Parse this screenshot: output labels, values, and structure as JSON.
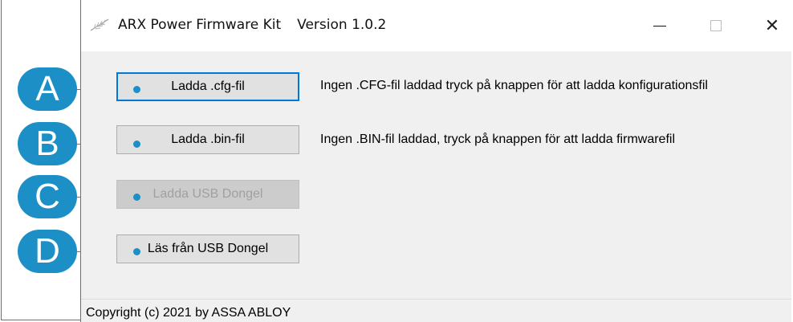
{
  "window": {
    "title": "ARX Power Firmware Kit",
    "version": "Version 1.0.2",
    "app_icon": "feather-icon",
    "minimize_icon": "minimize-icon",
    "maximize_icon": "maximize-icon",
    "close_icon": "close-icon",
    "close_glyph": "✕"
  },
  "buttons": {
    "load_cfg": "Ladda .cfg-fil",
    "load_bin": "Ladda .bin-fil",
    "load_usb": "Ladda USB Dongel",
    "read_usb": "Läs från USB Dongel"
  },
  "status": {
    "cfg": "Ingen .CFG-fil laddad tryck på knappen för att ladda konfigurationsfil",
    "bin": "Ingen .BIN-fil laddad, tryck på knappen för att ladda firmwarefil"
  },
  "footer": {
    "copyright": "Copyright (c) 2021 by ASSA ABLOY"
  },
  "callouts": {
    "a": "A",
    "b": "B",
    "c": "C",
    "d": "D",
    "color": "#1b8fc6"
  }
}
